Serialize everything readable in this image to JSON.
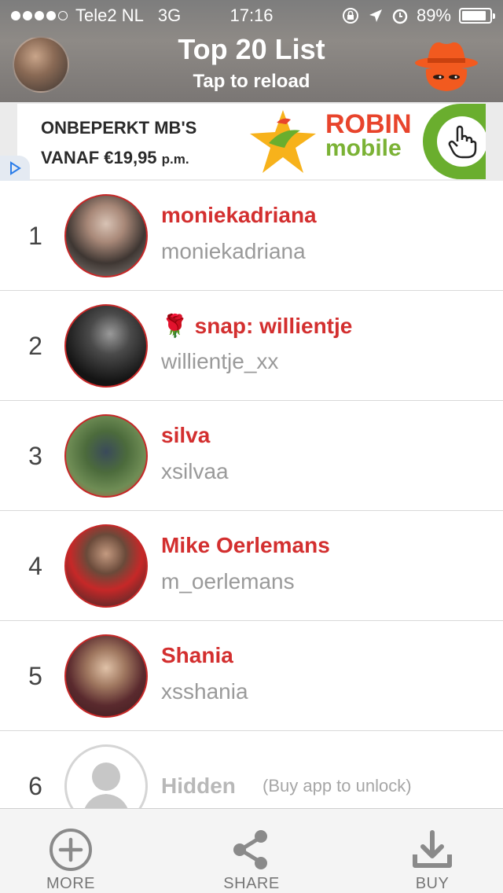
{
  "status_bar": {
    "carrier": "Tele2 NL",
    "network": "3G",
    "time": "17:16",
    "battery": "89%",
    "battery_level": 0.89
  },
  "header": {
    "title": "Top 20 List",
    "subtitle": "Tap to reload"
  },
  "ad": {
    "line1": "ONBEPERKT MB'S",
    "line2_main": "VANAF €19,95",
    "line2_suffix": "p.m.",
    "brand_top": "ROBIN",
    "brand_bottom": "mobile"
  },
  "list": [
    {
      "rank": "1",
      "name": "moniekadriana",
      "username": "moniekadriana"
    },
    {
      "rank": "2",
      "name": "🌹 snap: willientje",
      "username": "willientje_xx"
    },
    {
      "rank": "3",
      "name": "silva",
      "username": "xsilvaa"
    },
    {
      "rank": "4",
      "name": "Mike Oerlemans",
      "username": "m_oerlemans"
    },
    {
      "rank": "5",
      "name": "Shania",
      "username": "xsshania"
    },
    {
      "rank": "6",
      "name": "Hidden",
      "note": "(Buy app to unlock)"
    }
  ],
  "bottom_bar": {
    "more": "MORE",
    "share": "SHARE",
    "buy": "BUY"
  },
  "colors": {
    "accent_red": "#d32f2f",
    "icon_gray": "#8a8a8a"
  }
}
